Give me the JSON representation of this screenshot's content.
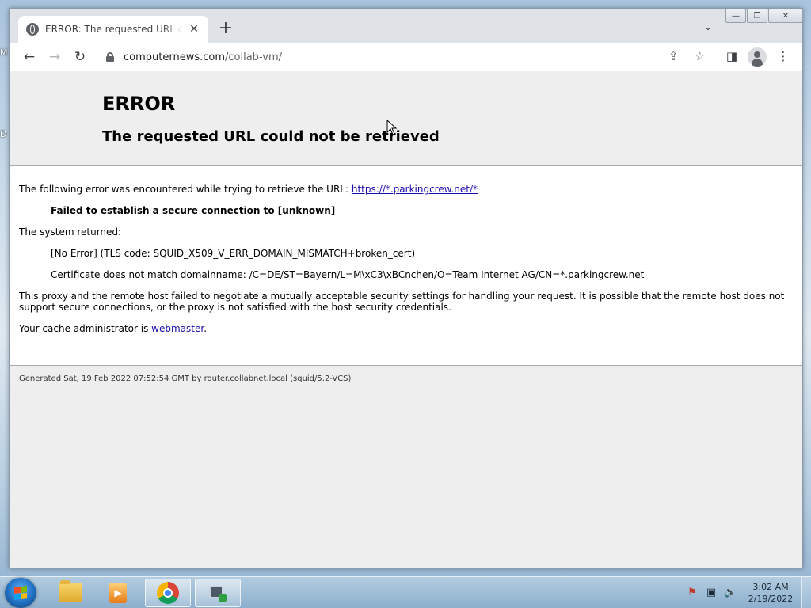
{
  "desktop": {
    "edge_fragments": [
      "M",
      "D"
    ]
  },
  "browser": {
    "tab": {
      "title": "ERROR: The requested URL could not be retrieved",
      "close": "✕"
    },
    "new_tab": "+",
    "tab_search": "⌄",
    "caption": {
      "minimize": "—",
      "restore": "❐",
      "close": "✕"
    },
    "nav": {
      "back": "←",
      "forward": "→",
      "reload": "↻"
    },
    "address": {
      "host": "computernews.com",
      "path": "/collab-vm/"
    },
    "toolbar_icons": {
      "share": "⇪",
      "bookmark": "☆",
      "side_panel": "◨",
      "menu": "⋮"
    }
  },
  "page": {
    "title": "ERROR",
    "subtitle": "The requested URL could not be retrieved",
    "intro_text": "The following error was encountered while trying to retrieve the URL: ",
    "intro_link": "https://*.parkingcrew.net/*",
    "error_bold": "Failed to establish a secure connection to [unknown]",
    "system_returned": "The system returned:",
    "no_error": "[No Error] (TLS code: SQUID_X509_V_ERR_DOMAIN_MISMATCH+broken_cert)",
    "cert_mismatch": "Certificate does not match domainname: /C=DE/ST=Bayern/L=M\\xC3\\xBCnchen/O=Team Internet AG/CN=*.parkingcrew.net",
    "explanation": "This proxy and the remote host failed to negotiate a mutually acceptable security settings for handling your request. It is possible that the remote host does not support secure connections, or the proxy is not satisfied with the host security credentials.",
    "admin_prefix": "Your cache administrator is ",
    "admin_link": "webmaster",
    "admin_suffix": ".",
    "footer": "Generated Sat, 19 Feb 2022 07:52:54 GMT by router.collabnet.local (squid/5.2-VCS)"
  },
  "taskbar": {
    "tray_icons": [
      "flag-x-icon",
      "network-icon",
      "volume-icon"
    ],
    "tray_glyphs": [
      "⚑",
      "▣",
      "🔈"
    ],
    "time": "3:02 AM",
    "date": "2/19/2022"
  }
}
